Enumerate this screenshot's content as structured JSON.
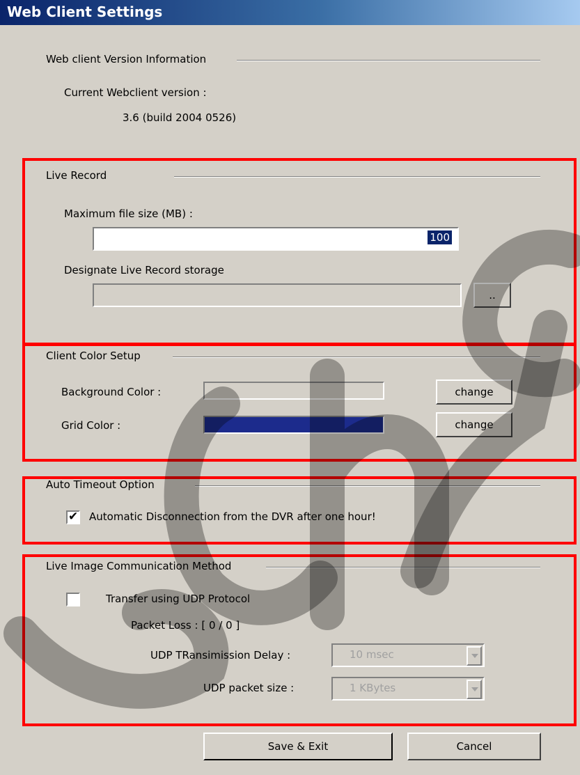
{
  "window": {
    "title": "Web Client Settings"
  },
  "version_group": {
    "title": "Web client Version Information",
    "current_label": "Current Webclient version :",
    "current_value": "3.6  (build 2004 0526)"
  },
  "live_record": {
    "title": "Live Record",
    "max_size_label": "Maximum file size (MB) :",
    "max_size_value": "100",
    "storage_label": "Designate Live Record storage",
    "storage_value": "",
    "browse_label": ".."
  },
  "color_setup": {
    "title": "Client Color Setup",
    "background_label": "Background Color :",
    "background_color": "#d4d0c8",
    "grid_label": "Grid Color :",
    "grid_color": "#1c2b8c",
    "change_label": "change"
  },
  "auto_timeout": {
    "title": "Auto Timeout Option",
    "checkbox_label": "Automatic Disconnection from the DVR after one hour!",
    "checked": true
  },
  "communication": {
    "title": "Live Image Communication Method",
    "udp_label": "Transfer using UDP Protocol",
    "udp_checked": false,
    "packet_loss": "Packet Loss : [ 0 / 0 ]",
    "delay_label": "UDP TRansimission Delay :",
    "delay_value": "10 msec",
    "packet_size_label": "UDP packet size :",
    "packet_size_value": "1 KBytes"
  },
  "buttons": {
    "save": "Save & Exit",
    "cancel": "Cancel"
  },
  "colors": {
    "highlight_box": "#ff0000",
    "titlebar": "#0a246a",
    "watermark": "#000000"
  }
}
